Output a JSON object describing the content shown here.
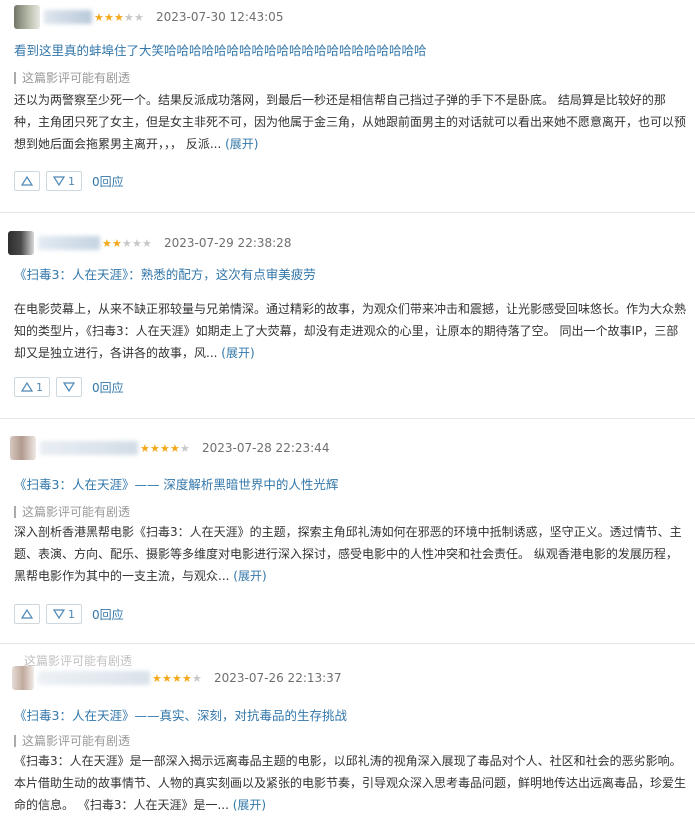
{
  "reviews": [
    {
      "stars": 3,
      "time": "2023-07-30 12:43:05",
      "title": "看到这里真的蚌埠住了大笑哈哈哈哈哈哈哈哈哈哈哈哈哈哈哈哈哈哈哈哈哈",
      "spoiler": "这篇影评可能有剧透",
      "body": "还以为两警察至少死一个。结果反派成功落网，到最后一秒还是相信帮自己挡过子弹的手下不是卧底。 结局算是比较好的那种，主角团只死了女主，但是女主非死不可，因为他属于金三角，从她跟前面男主的对话就可以看出来她不愿意离开，也可以预想到她后面会拖累男主离开，，， 反派...",
      "expand": "(展开)",
      "up": "",
      "down": "1",
      "reply": "0回应"
    },
    {
      "stars": 2,
      "time": "2023-07-29 22:38:28",
      "title": "《扫毒3：人在天涯》：熟悉的配方，这次有点审美疲劳",
      "spoiler": "",
      "body": "在电影荧幕上，从来不缺正邪较量与兄弟情深。通过精彩的故事，为观众们带来冲击和震撼，让光影感受回味悠长。作为大众熟知的类型片，《扫毒3：人在天涯》如期走上了大荧幕，却没有走进观众的心里，让原本的期待落了空。 同出一个故事IP，三部却又是独立进行，各讲各的故事，风...",
      "expand": "(展开)",
      "up": "1",
      "down": "",
      "reply": "0回应"
    },
    {
      "stars": 4,
      "time": "2023-07-28 22:23:44",
      "title": "《扫毒3：人在天涯》—— 深度解析黑暗世界中的人性光辉",
      "spoiler": "这篇影评可能有剧透",
      "body": "深入剖析香港黑帮电影《扫毒3：人在天涯》的主题，探索主角邱礼涛如何在邪恶的环境中抵制诱惑，坚守正义。透过情节、主题、表演、方向、配乐、摄影等多维度对电影进行深入探讨，感受电影中的人性冲突和社会责任。 纵观香港电影的发展历程，黑帮电影作为其中的一支主流，与观众...",
      "expand": "(展开)",
      "up": "",
      "down": "1",
      "reply": "0回应"
    },
    {
      "stars": 4,
      "time": "2023-07-26 22:13:37",
      "title": "《扫毒3：人在天涯》——真实、深刻，对抗毒品的生存挑战",
      "spoiler": "这篇影评可能有剧透",
      "body": "《扫毒3：人在天涯》是一部深入揭示远离毒品主题的电影，以邱礼涛的视角深入展现了毒品对个人、社区和社会的恶劣影响。本片借助生动的故事情节、人物的真实刻画以及紧张的电影节奏，引导观众深入思考毒品问题，鲜明地传达出远离毒品，珍爱生命的信息。 《扫毒3：人在天涯》是一...",
      "expand": "(展开)",
      "up": "",
      "down": "",
      "reply": ""
    }
  ],
  "header_overlay_text": "这篇影评可能有剧透",
  "colors": {
    "link": "#3377aa",
    "star_on": "#f4a91c",
    "star_off": "#c9c9c9",
    "text": "#333333",
    "muted": "#999999"
  },
  "icons": [
    "up-vote-icon",
    "down-vote-icon",
    "star-icon"
  ]
}
